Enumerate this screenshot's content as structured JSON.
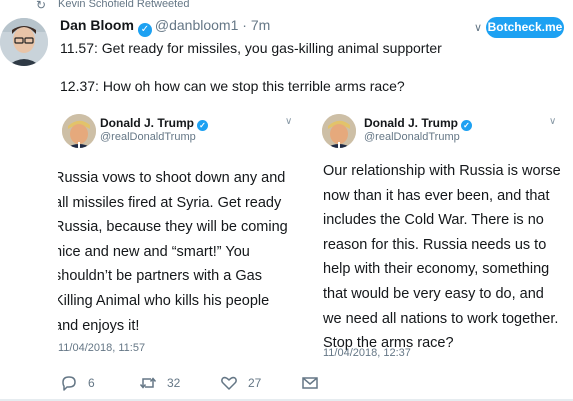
{
  "retweet_bar": {
    "text": "Kevin Schofield Retweeted",
    "icon": "retweet-icon"
  },
  "tweet": {
    "author_name": "Dan Bloom",
    "handle": "@danbloom1",
    "separator": "·",
    "time": "7m",
    "line1": "11.57: Get ready for missiles, you gas-killing animal supporter",
    "line2": "12.37: How oh how can we stop this terrible arms race?"
  },
  "botcheck": {
    "label": "Botcheck.me"
  },
  "embeds": [
    {
      "name": "Donald J. Trump",
      "handle": "@realDonaldTrump",
      "lines": [
        "Russia vows to shoot down any and",
        "all missiles fired at Syria. Get ready",
        "Russia,  because they will be coming",
        "nice and new and “smart!” You",
        "shouldn’t be partners with a Gas",
        "Killing Animal who kills his people",
        "and enjoys it!"
      ],
      "date": "11/04/2018, 11:57"
    },
    {
      "name": "Donald J. Trump",
      "handle": "@realDonaldTrump",
      "lines": [
        "Our relationship with Russia is worse",
        "now than it has ever been, and that",
        "includes the Cold War. There is no",
        "reason for this. Russia needs us to",
        "help with their economy, something",
        "that would be very easy to do, and",
        "we need all nations to work together.",
        "Stop the arms race?"
      ],
      "date": "11/04/2018, 12:37"
    }
  ],
  "actions": {
    "reply_count": "6",
    "retweet_count": "32",
    "like_count": "27"
  },
  "colors": {
    "accent": "#1da1f2",
    "muted": "#657786",
    "text": "#14171a",
    "retweet_green": "#657786"
  }
}
